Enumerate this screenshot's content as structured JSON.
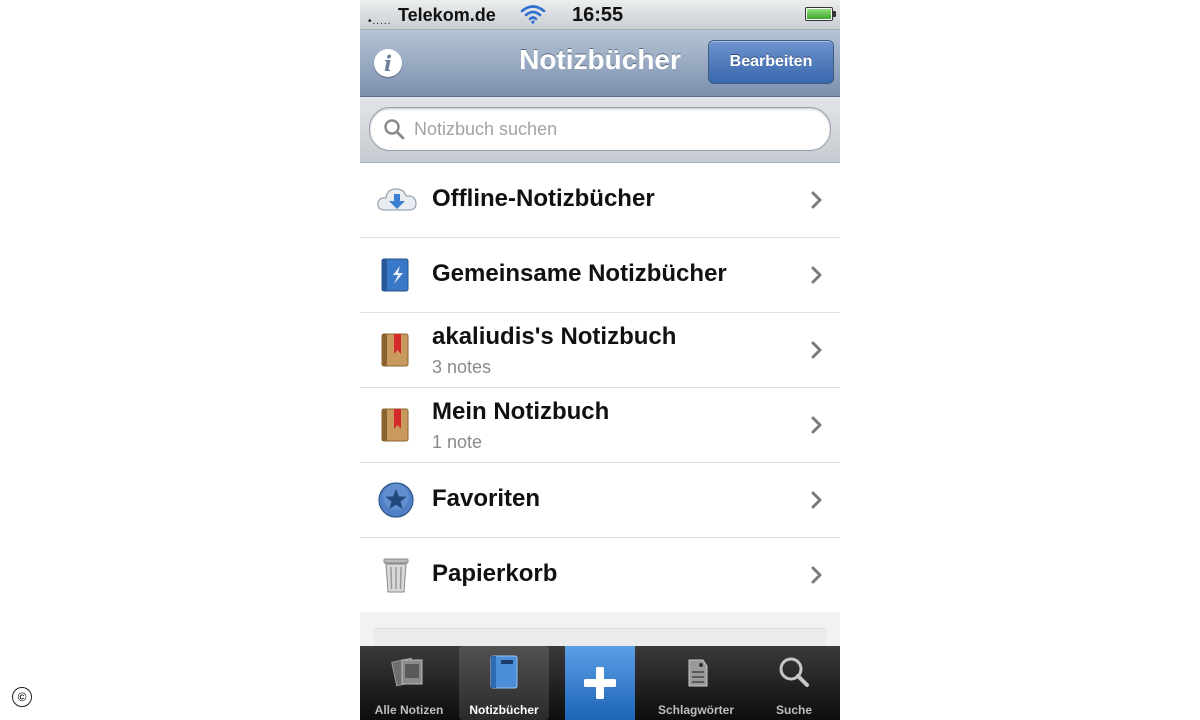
{
  "status_bar": {
    "signal": "•.....",
    "carrier": "Telekom.de",
    "time": "16:55",
    "wifi_icon": "wifi-icon",
    "battery_icon": "battery-full-icon"
  },
  "nav": {
    "info_icon": "info-icon",
    "info_glyph": "i",
    "title": "Notizbücher",
    "edit_label": "Bearbeiten"
  },
  "search": {
    "placeholder": "Notizbuch suchen",
    "value": ""
  },
  "list": {
    "items": [
      {
        "icon": "cloud-download-icon",
        "title": "Offline-Notizbücher",
        "subtitle": ""
      },
      {
        "icon": "shared-notebook-icon",
        "title": "Gemeinsame Notizbücher",
        "subtitle": ""
      },
      {
        "icon": "notebook-icon",
        "title": "akaliudis's Notizbuch",
        "subtitle": "3 notes"
      },
      {
        "icon": "notebook-icon",
        "title": "Mein Notizbuch",
        "subtitle": "1 note"
      },
      {
        "icon": "star-icon",
        "title": "Favoriten",
        "subtitle": ""
      },
      {
        "icon": "trash-icon",
        "title": "Papierkorb",
        "subtitle": ""
      }
    ]
  },
  "tabbar": {
    "tabs": [
      {
        "icon": "notes-stack-icon",
        "label": "Alle Notizen",
        "active": false
      },
      {
        "icon": "notebook-tab-icon",
        "label": "Notizbücher",
        "active": true
      },
      {
        "icon": "plus-icon",
        "label": "",
        "active": false
      },
      {
        "icon": "tag-icon",
        "label": "Schlagwörter",
        "active": false
      },
      {
        "icon": "search-icon",
        "label": "Suche",
        "active": false
      }
    ]
  },
  "watermark": "©",
  "colors": {
    "nav_bar": "#8799b4",
    "edit_button": "#3f6fb5",
    "plus_button": "#2f7fd6",
    "tab_bar": "#1a1a1a"
  }
}
